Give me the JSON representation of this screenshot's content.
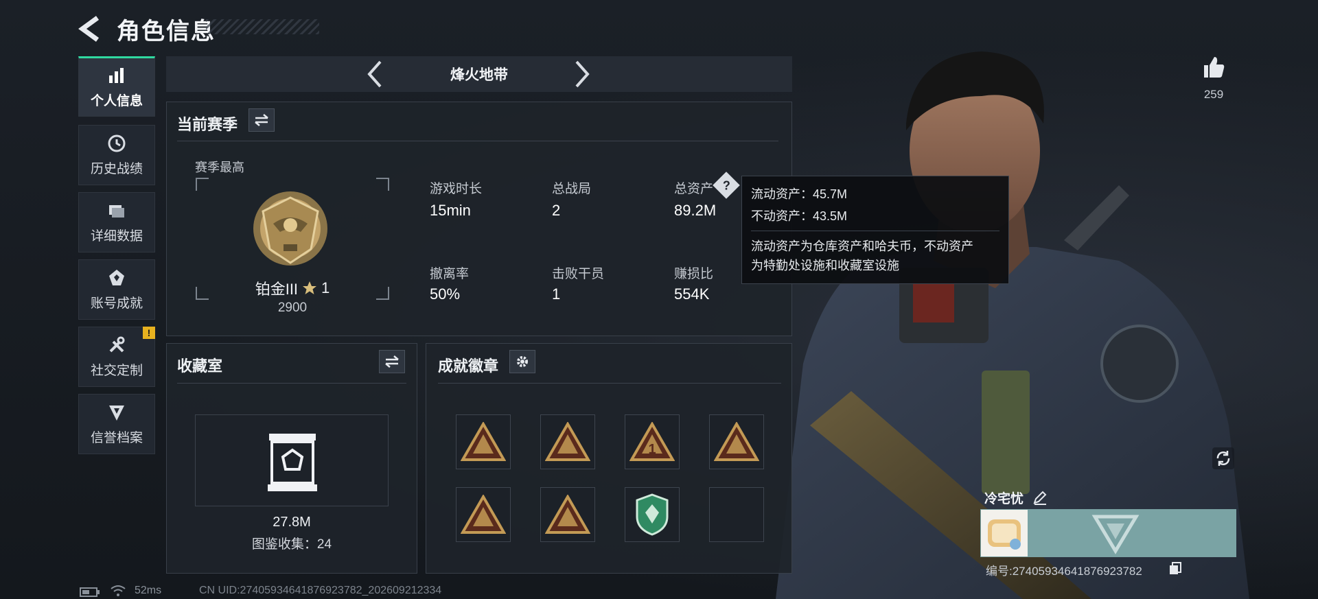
{
  "header": {
    "title": "角色信息"
  },
  "sidebar": {
    "items": [
      {
        "label": "个人信息",
        "icon": "bar-chart-icon",
        "active": true
      },
      {
        "label": "历史战绩",
        "icon": "history-clock-icon"
      },
      {
        "label": "详细数据",
        "icon": "folders-icon"
      },
      {
        "label": "账号成就",
        "icon": "achievement-emblem-icon"
      },
      {
        "label": "社交定制",
        "icon": "tools-icon",
        "badge": "!"
      },
      {
        "label": "信誉档案",
        "icon": "shield-emblem-icon"
      }
    ]
  },
  "mode": {
    "name": "烽火地带"
  },
  "likes": {
    "count": "259"
  },
  "season": {
    "title": "当前赛季",
    "best_label": "赛季最高",
    "rank_name": "铂金III",
    "rank_stars": "1",
    "rank_points": "2900",
    "stats": [
      {
        "label": "游戏时长",
        "value": "15min"
      },
      {
        "label": "总战局",
        "value": "2"
      },
      {
        "label": "总资产",
        "value": "89.2M",
        "has_help": true
      },
      {
        "label": "撤离率",
        "value": "50%"
      },
      {
        "label": "击败干员",
        "value": "1"
      },
      {
        "label": "赚损比",
        "value": "554K"
      }
    ],
    "help_icon_text": "?"
  },
  "tooltip": {
    "liquid": "流动资产：45.7M",
    "fixed": "不动资产：43.5M",
    "desc_line1": "流动资产为仓库资产和哈夫币，不动资产",
    "desc_line2": "为特勤处设施和收藏室设施"
  },
  "collection": {
    "title": "收藏室",
    "value": "27.8M",
    "catalog": "图鉴收集：24"
  },
  "badges": {
    "title": "成就徽章",
    "items": [
      {
        "icon": "triangle-badge-icon",
        "color": "#c39a55"
      },
      {
        "icon": "triangle-badge-icon",
        "color": "#c39a55"
      },
      {
        "icon": "triangle-badge-icon",
        "color": "#c39a55",
        "text": "1"
      },
      {
        "icon": "triangle-badge-icon",
        "color": "#c39a55"
      },
      {
        "icon": "triangle-badge-icon",
        "color": "#c39a55"
      },
      {
        "icon": "triangle-badge-icon",
        "color": "#c39a55"
      },
      {
        "icon": "shield-badge-icon",
        "color": "#2f8a62"
      },
      {
        "icon": "empty",
        "color": ""
      }
    ]
  },
  "player": {
    "name": "冷宅忧",
    "id_line": "编号:2740593464187692378​2"
  },
  "footer": {
    "ping": "52ms",
    "uid": "CN UID:2740593464187692378​2_202609212334"
  },
  "colors": {
    "accent": "#2fd9a0",
    "warning": "#e8b21f",
    "gold": "#c39a55"
  }
}
